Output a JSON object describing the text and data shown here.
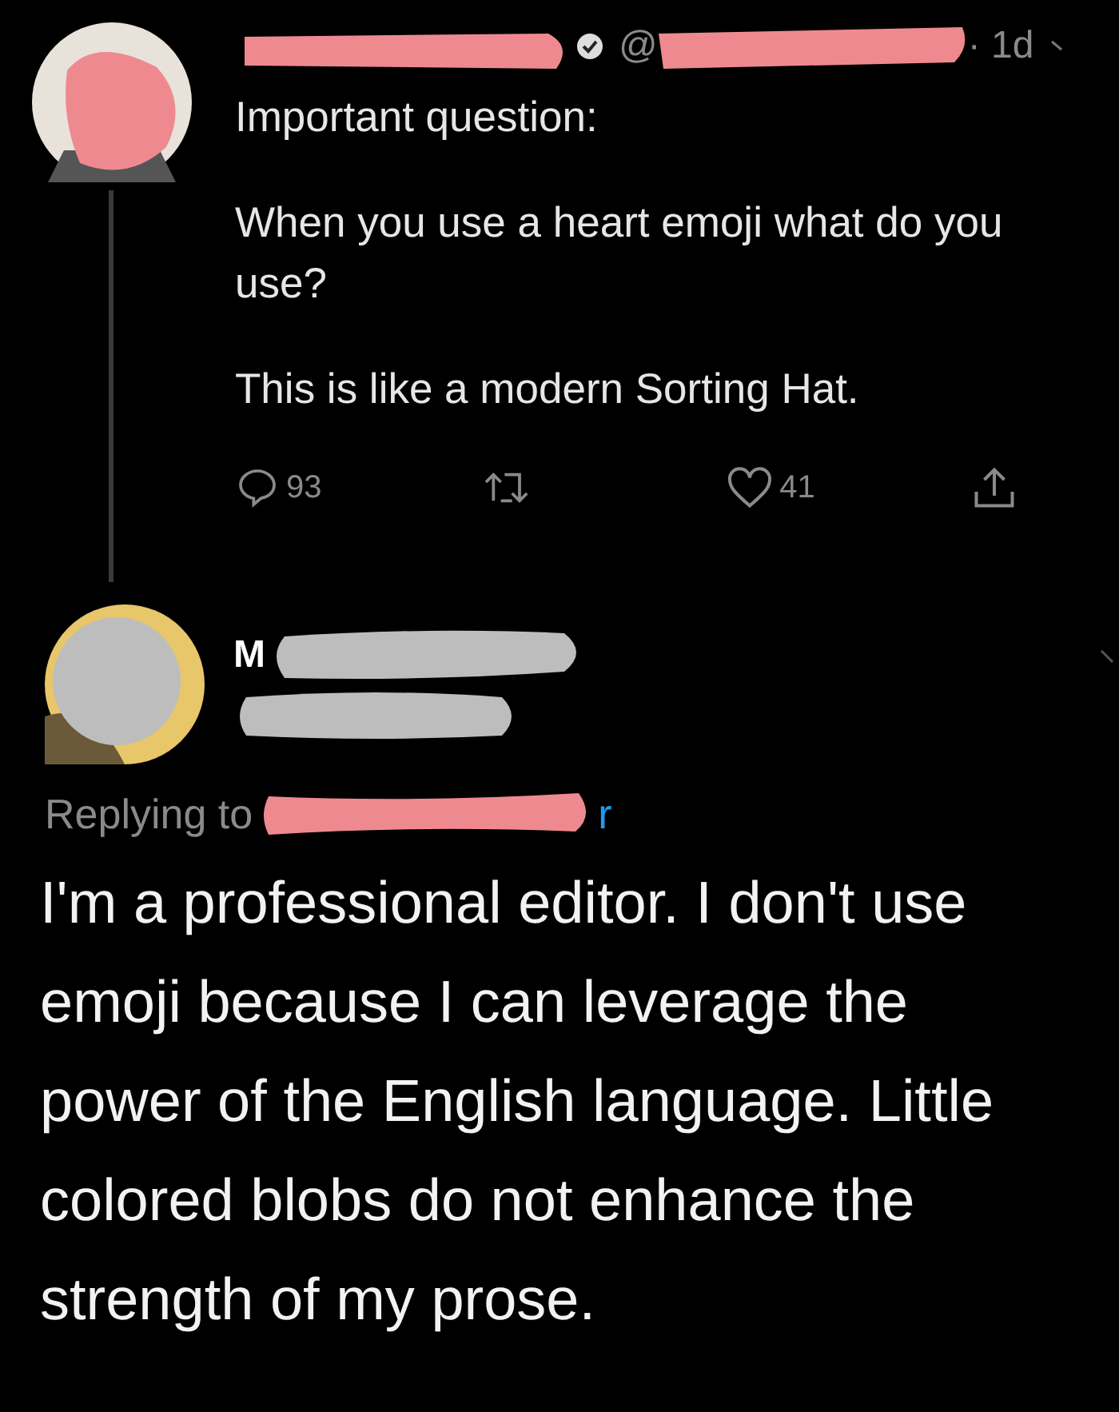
{
  "tweet": {
    "handle_prefix": "@",
    "time": "· 1d",
    "paragraphs": [
      "Important question:",
      "When you use a heart emoji what do you use?",
      "This is like a modern Sorting Hat."
    ],
    "actions": [
      {
        "kind": "reply",
        "count": "93"
      },
      {
        "kind": "retweet"
      },
      {
        "kind": "like",
        "count": "41"
      },
      {
        "kind": "share"
      }
    ]
  },
  "reply": {
    "name_visible": "M",
    "replying_label": "Replying to",
    "replying_handle_end": "r",
    "text": "I'm a professional editor. I don't use emoji because I can leverage the power of the English language. Little colored blobs do not enhance the strength of my prose."
  }
}
